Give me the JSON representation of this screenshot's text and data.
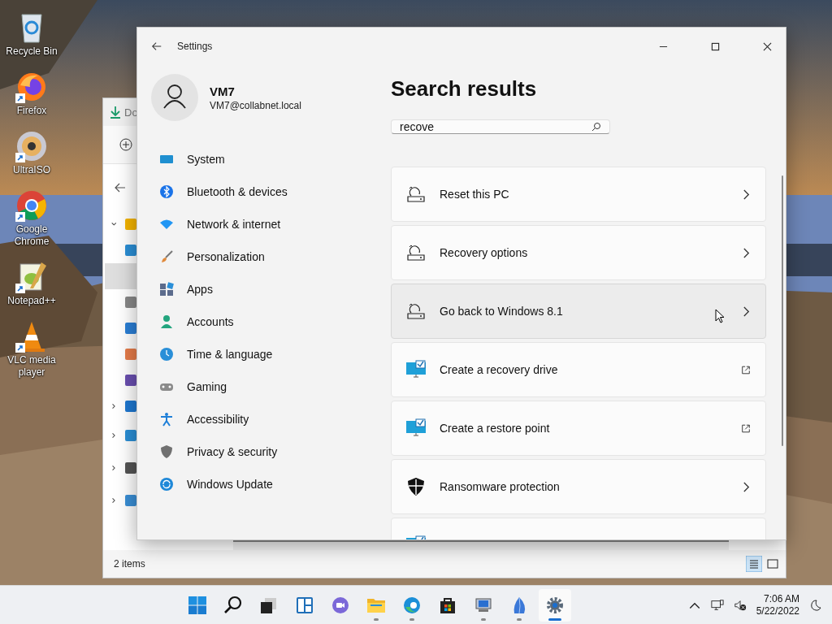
{
  "desktop_icons": [
    {
      "label": "Recycle Bin",
      "kind": "recycle",
      "shortcut": false
    },
    {
      "label": "Firefox",
      "kind": "firefox",
      "shortcut": true
    },
    {
      "label": "UltraISO",
      "kind": "disc",
      "shortcut": true
    },
    {
      "label": "Google Chrome",
      "kind": "chrome",
      "shortcut": true
    },
    {
      "label": "Notepad++",
      "kind": "notepad",
      "shortcut": true
    },
    {
      "label": "VLC media player",
      "kind": "cone",
      "shortcut": true
    }
  ],
  "explorer": {
    "tab_title": "Do",
    "status": "2 items",
    "tree": [
      {
        "kind": "star",
        "expanded": true,
        "selected": false,
        "children": [
          {
            "kind": "desktop",
            "selected": false
          },
          {
            "kind": "blank",
            "selected": true
          },
          {
            "kind": "doc",
            "selected": false
          },
          {
            "kind": "blue",
            "selected": false
          },
          {
            "kind": "orange",
            "selected": false
          },
          {
            "kind": "purple",
            "selected": false
          }
        ]
      },
      {
        "kind": "cloud",
        "expanded": false,
        "selected": false
      },
      {
        "kind": "pc",
        "expanded": false,
        "selected": false
      },
      {
        "kind": "drive",
        "expanded": false,
        "selected": false
      },
      {
        "kind": "network",
        "expanded": false,
        "selected": false
      }
    ],
    "view_buttons": [
      {
        "kind": "details",
        "selected": true
      },
      {
        "kind": "tiles",
        "selected": false
      }
    ]
  },
  "settings": {
    "title": "Settings",
    "user": {
      "name": "VM7",
      "email": "VM7@collabnet.local"
    },
    "nav": [
      {
        "label": "System",
        "kind": "system"
      },
      {
        "label": "Bluetooth & devices",
        "kind": "bluetooth"
      },
      {
        "label": "Network & internet",
        "kind": "network"
      },
      {
        "label": "Personalization",
        "kind": "personalization"
      },
      {
        "label": "Apps",
        "kind": "apps"
      },
      {
        "label": "Accounts",
        "kind": "accounts"
      },
      {
        "label": "Time & language",
        "kind": "time"
      },
      {
        "label": "Gaming",
        "kind": "gaming"
      },
      {
        "label": "Accessibility",
        "kind": "accessibility"
      },
      {
        "label": "Privacy & security",
        "kind": "privacy"
      },
      {
        "label": "Windows Update",
        "kind": "update"
      }
    ],
    "heading": "Search results",
    "search": {
      "value": "recove"
    },
    "results": [
      {
        "label": "Reset this PC",
        "kind": "restore",
        "hovered": false
      },
      {
        "label": "Recovery options",
        "kind": "restore",
        "hovered": false
      },
      {
        "label": "Go back to Windows 8.1",
        "kind": "restore",
        "hovered": true
      },
      {
        "label": "Create a recovery drive",
        "kind": "control-panel",
        "hovered": false
      },
      {
        "label": "Create a restore point",
        "kind": "control-panel",
        "hovered": false
      },
      {
        "label": "Ransomware protection",
        "kind": "security",
        "hovered": false
      },
      {
        "kind": "control-panel",
        "hovered": false
      }
    ]
  },
  "taskbar": {
    "apps": [
      {
        "kind": "start",
        "running": false,
        "active": false
      },
      {
        "kind": "search",
        "running": false,
        "active": false
      },
      {
        "kind": "taskview",
        "running": false,
        "active": false
      },
      {
        "kind": "widgets",
        "running": false,
        "active": false
      },
      {
        "kind": "chat",
        "running": false,
        "active": false
      },
      {
        "kind": "explorer",
        "running": true,
        "active": false
      },
      {
        "kind": "edge",
        "running": true,
        "active": false
      },
      {
        "kind": "store",
        "running": false,
        "active": false
      },
      {
        "kind": "remote",
        "running": true,
        "active": false
      },
      {
        "kind": "sail",
        "running": true,
        "active": false
      },
      {
        "kind": "settings",
        "running": true,
        "active": true
      }
    ],
    "time": "7:06 AM",
    "date": "5/22/2022"
  }
}
